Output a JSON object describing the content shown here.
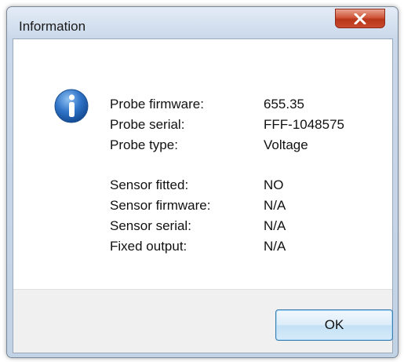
{
  "window": {
    "title": "Information"
  },
  "details": {
    "probe": [
      {
        "label": "Probe firmware:",
        "value": "655.35"
      },
      {
        "label": "Probe serial:",
        "value": "FFF-1048575"
      },
      {
        "label": "Probe type:",
        "value": "Voltage"
      }
    ],
    "sensor": [
      {
        "label": "Sensor fitted:",
        "value": "NO"
      },
      {
        "label": "Sensor firmware:",
        "value": "N/A"
      },
      {
        "label": "Sensor serial:",
        "value": "N/A"
      },
      {
        "label": "Fixed output:",
        "value": "N/A"
      }
    ]
  },
  "buttons": {
    "ok_label": "OK"
  },
  "icons": {
    "info": "info-icon",
    "close": "close-icon"
  }
}
